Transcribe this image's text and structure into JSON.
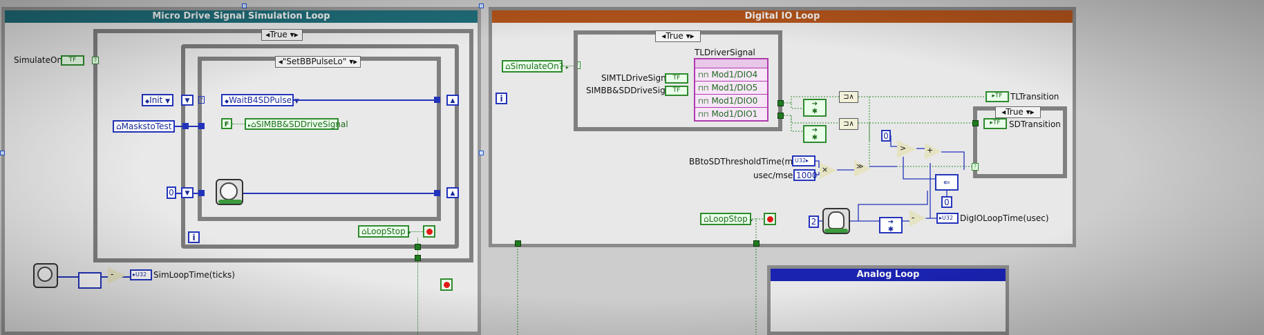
{
  "loops": {
    "micro_drive": {
      "title": "Micro Drive Signal Simulation Loop"
    },
    "digital_io": {
      "title": "Digital IO Loop"
    },
    "analog": {
      "title": "Analog Loop"
    }
  },
  "left": {
    "simulate_on": "SimulateOn?",
    "simulate_tf": "TF",
    "case_true": "True",
    "init": "Init",
    "state_case": "\"SetBBPulseLo\"",
    "wait_state": "WaitB4SDPulse",
    "masks_to_test": "MaskstoTest",
    "f_const": "F",
    "simbb_local": "SIMBB&SDDriveSignal",
    "zero_const": "0",
    "loop_stop": "LoopStop",
    "iter_i": "i",
    "u32": "U32",
    "sim_loop_time": "SimLoopTime(ticks)"
  },
  "right": {
    "simulate_on": "SimulateOn?",
    "iter_i": "i",
    "case_true": "True",
    "tl_driver_signal": "TLDriverSignal",
    "sim_tl_drive_signal": "SIMTLDriveSignal",
    "simbb_sd_drive_signal": "SIMBB&SDDriveSignal",
    "tf": "TF",
    "dio": [
      "Mod1/DIO4",
      "Mod1/DIO5",
      "Mod1/DIO0",
      "Mod1/DIO1"
    ],
    "tl_transition": "TLTransition",
    "sd_transition": "SDTransition",
    "inner_case_true": "True",
    "zero_const": "0",
    "zero_const_b": "0",
    "bb_to_sd": "BBtoSDThresholdTime(msec)",
    "u32": "U32",
    "usec_per_msec": "usec/msec",
    "thousand": "1000",
    "loop_stop": "LoopStop",
    "two_const": "2",
    "dig_io_loop_time": "DigIOLoopTime(usec)"
  },
  "colors": {
    "teal_title": "#1f6e7a",
    "orange_title": "#b3541b",
    "blue_title": "#1a22b0",
    "wire_blue": "#2233bb",
    "wire_green": "#2c8a2c",
    "pink_node": "#b03ab0"
  }
}
